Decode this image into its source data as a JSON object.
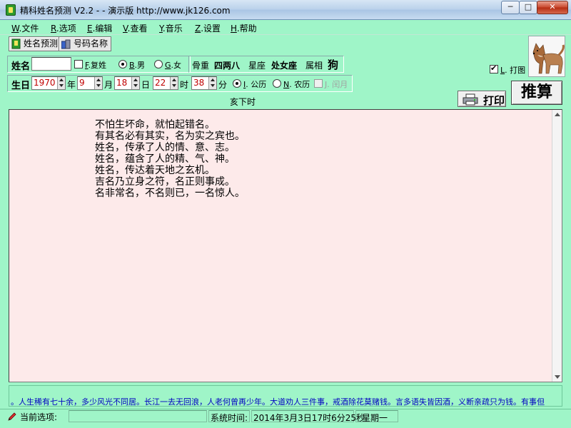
{
  "window": {
    "title": "精科姓名预测 V2.2 -  - 演示版  http://www.jk126.com",
    "minimize": "─",
    "maximize": "□",
    "close": "✕"
  },
  "menu": [
    {
      "accel": "W",
      "label": ".文件"
    },
    {
      "accel": "R",
      "label": ".选项"
    },
    {
      "accel": "E",
      "label": ".编辑"
    },
    {
      "accel": "V",
      "label": ".查看"
    },
    {
      "accel": "Y",
      "label": ".音乐"
    },
    {
      "accel": "Z",
      "label": ".设置"
    },
    {
      "accel": "H",
      "label": ".帮助"
    }
  ],
  "toolbar": {
    "name_predict": "姓名预测",
    "number_name": "号码名称"
  },
  "name_row": {
    "name_label": "姓名",
    "name_value": "",
    "compound_accel": "F",
    "compound_label": ".复姓",
    "male_accel": "B",
    "male_label": ".男",
    "female_accel": "G",
    "female_label": ".女",
    "bone_weight_label": "骨重",
    "bone_weight_value": "四两八",
    "zodiac_sign_label": "星座",
    "zodiac_sign_value": "处女座",
    "chinese_zodiac_label": "属相",
    "chinese_zodiac_value": "狗",
    "print_image_accel": "L",
    "print_image_label": ". 打图"
  },
  "birth_row": {
    "label": "生日",
    "year": "1970",
    "year_unit": "年",
    "month": "9",
    "month_unit": "月",
    "day": "18",
    "day_unit": "日",
    "hour": "22",
    "hour_unit": "时",
    "minute": "38",
    "minute_unit": "分",
    "solar_accel": "I",
    "solar_label": ". 公历",
    "lunar_accel": "N",
    "lunar_label": ". 农历",
    "leap_accel": "J",
    "leap_label": ". 闰月",
    "shichen": "亥下时"
  },
  "buttons": {
    "print": "打印",
    "calculate": "推算"
  },
  "poem": [
    "不怕生坏命，就怕起错名。",
    "有其名必有其实，名为实之宾也。",
    "姓名，传承了人的情、意、志。",
    "姓名，蕴含了人的精、气、神。",
    "姓名，传达着天地之玄机。",
    "吉名乃立身之符，名正则事成。",
    "名非常名，不名则已，一名惊人。"
  ],
  "marquee": "。人生稀有七十余，多少风光不同居。长江一去无回浪，人老何曾再少年。大道劝人三件事，戒酒除花莫赌钱。言多语失皆因酒，义断亲疏只为钱。有事但",
  "status": {
    "current_label": "当前选项:",
    "current_value": "",
    "time_label": "系统时间:",
    "time_value": "2014年3月3日17时6分25秒",
    "weekday": "星期一"
  },
  "colors": {
    "window_bg": "#9ff5c8",
    "text_area_bg": "#fdeaea",
    "date_value": "#c00000",
    "marquee_text": "#0000c0"
  }
}
